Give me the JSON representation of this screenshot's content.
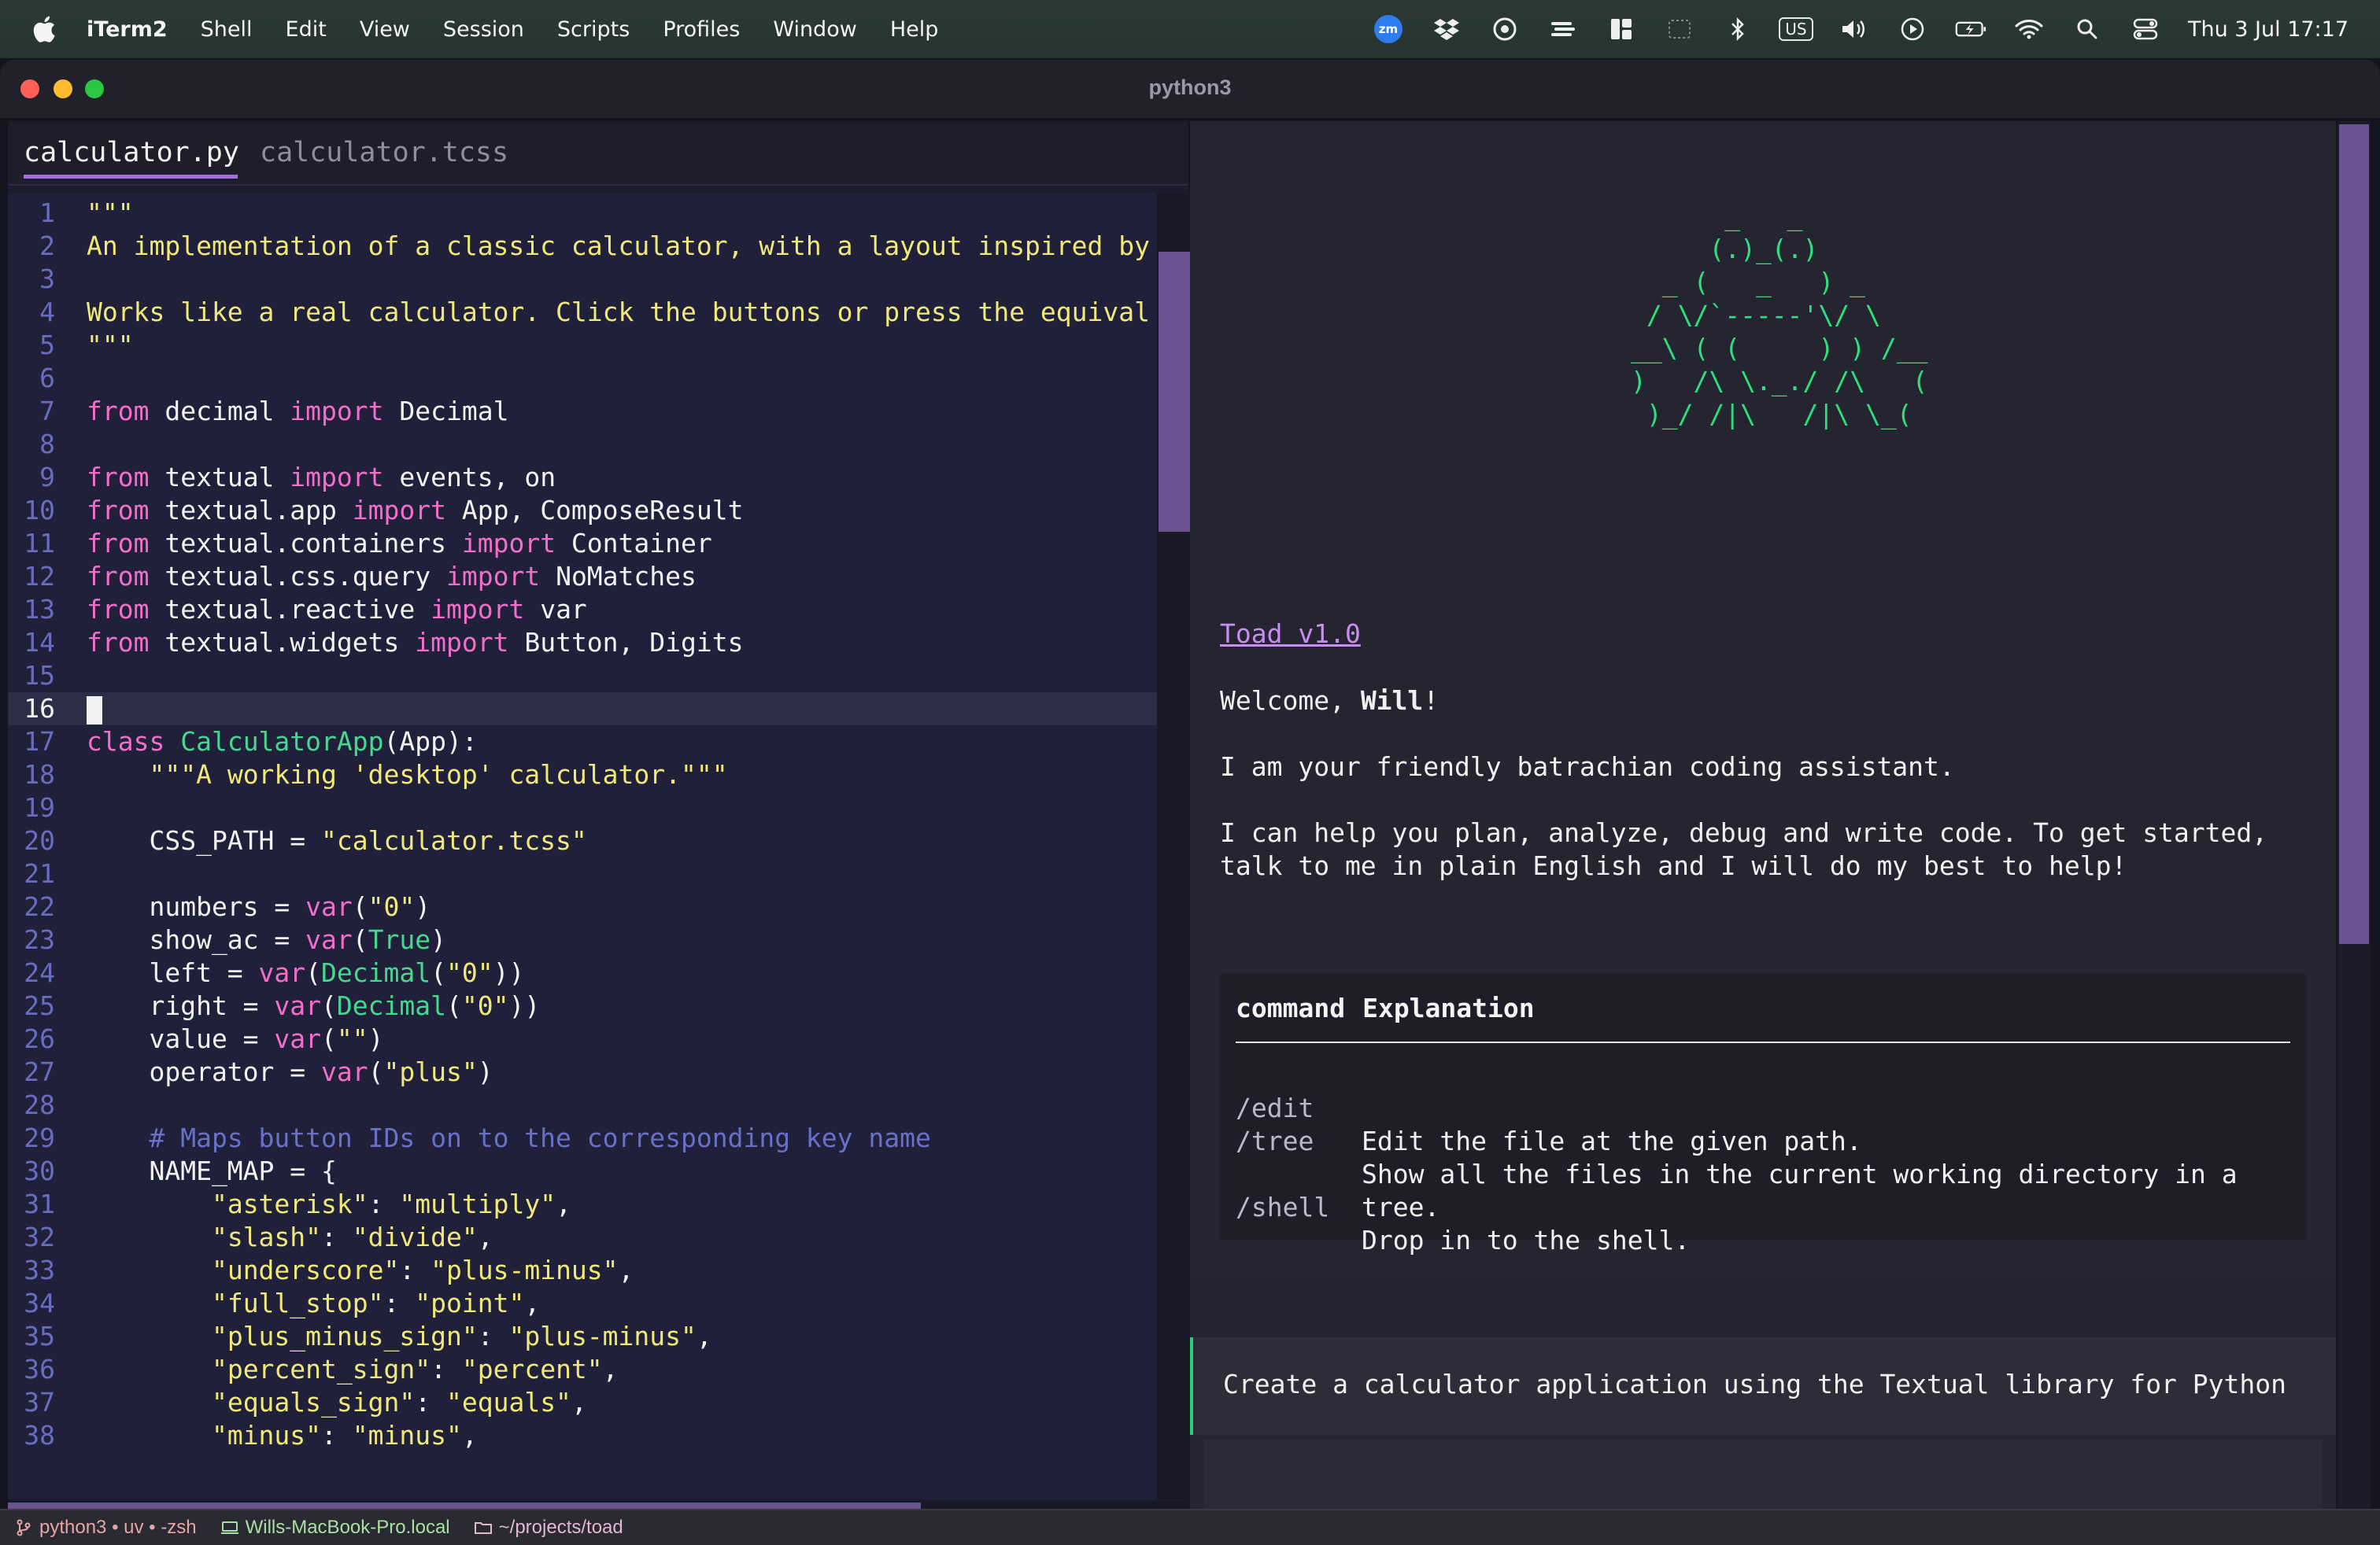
{
  "menubar": {
    "app_name": "iTerm2",
    "items": [
      "Shell",
      "Edit",
      "View",
      "Session",
      "Scripts",
      "Profiles",
      "Window",
      "Help"
    ],
    "status_icons": [
      "zoom-icon",
      "dropbox-icon",
      "screen-record-icon",
      "sync-icon",
      "layout-icon",
      "dashed-box-icon",
      "bluetooth-icon",
      "keyboard-layout-icon",
      "volume-icon",
      "play-icon",
      "battery-icon",
      "wifi-icon",
      "spotlight-icon",
      "control-center-icon"
    ],
    "zoom_label": "zm",
    "keyboard_label": "US",
    "clock": "Thu 3 Jul  17:17"
  },
  "window": {
    "title": "python3"
  },
  "editor": {
    "tabs": [
      {
        "label": "calculator.py",
        "active": true
      },
      {
        "label": "calculator.tcss",
        "active": false
      }
    ],
    "current_line": 16,
    "lines": [
      {
        "n": "1",
        "tokens": [
          [
            "str",
            "\"\"\""
          ]
        ]
      },
      {
        "n": "2",
        "tokens": [
          [
            "str",
            "An implementation of a classic calculator, with a layout inspired by"
          ]
        ]
      },
      {
        "n": "3",
        "tokens": []
      },
      {
        "n": "4",
        "tokens": [
          [
            "str",
            "Works like a real calculator. Click the buttons or press the equival"
          ]
        ]
      },
      {
        "n": "5",
        "tokens": [
          [
            "str",
            "\"\"\""
          ]
        ]
      },
      {
        "n": "6",
        "tokens": []
      },
      {
        "n": "7",
        "tokens": [
          [
            "kw",
            "from"
          ],
          [
            "txt",
            " decimal "
          ],
          [
            "kw",
            "import"
          ],
          [
            "txt",
            " Decimal"
          ]
        ]
      },
      {
        "n": "8",
        "tokens": []
      },
      {
        "n": "9",
        "tokens": [
          [
            "kw",
            "from"
          ],
          [
            "txt",
            " textual "
          ],
          [
            "kw",
            "import"
          ],
          [
            "txt",
            " events, on"
          ]
        ]
      },
      {
        "n": "10",
        "tokens": [
          [
            "kw",
            "from"
          ],
          [
            "txt",
            " textual.app "
          ],
          [
            "kw",
            "import"
          ],
          [
            "txt",
            " App, ComposeResult"
          ]
        ]
      },
      {
        "n": "11",
        "tokens": [
          [
            "kw",
            "from"
          ],
          [
            "txt",
            " textual.containers "
          ],
          [
            "kw",
            "import"
          ],
          [
            "txt",
            " Container"
          ]
        ]
      },
      {
        "n": "12",
        "tokens": [
          [
            "kw",
            "from"
          ],
          [
            "txt",
            " textual.css.query "
          ],
          [
            "kw",
            "import"
          ],
          [
            "txt",
            " NoMatches"
          ]
        ]
      },
      {
        "n": "13",
        "tokens": [
          [
            "kw",
            "from"
          ],
          [
            "txt",
            " textual.reactive "
          ],
          [
            "kw",
            "import"
          ],
          [
            "txt",
            " var"
          ]
        ]
      },
      {
        "n": "14",
        "tokens": [
          [
            "kw",
            "from"
          ],
          [
            "txt",
            " textual.widgets "
          ],
          [
            "kw",
            "import"
          ],
          [
            "txt",
            " Button, Digits"
          ]
        ]
      },
      {
        "n": "15",
        "tokens": []
      },
      {
        "n": "16",
        "tokens": [
          [
            "caret",
            ""
          ]
        ]
      },
      {
        "n": "17",
        "tokens": [
          [
            "kw",
            "class"
          ],
          [
            "txt",
            " "
          ],
          [
            "cls",
            "CalculatorApp"
          ],
          [
            "txt",
            "(App):"
          ]
        ]
      },
      {
        "n": "18",
        "tokens": [
          [
            "txt",
            "    "
          ],
          [
            "str",
            "\"\"\"A working 'desktop' calculator.\"\"\""
          ]
        ]
      },
      {
        "n": "19",
        "tokens": []
      },
      {
        "n": "20",
        "tokens": [
          [
            "txt",
            "    CSS_PATH = "
          ],
          [
            "str",
            "\"calculator.tcss\""
          ]
        ]
      },
      {
        "n": "21",
        "tokens": []
      },
      {
        "n": "22",
        "tokens": [
          [
            "txt",
            "    numbers = "
          ],
          [
            "kw",
            "var"
          ],
          [
            "txt",
            "("
          ],
          [
            "str",
            "\"0\""
          ],
          [
            "txt",
            ")"
          ]
        ]
      },
      {
        "n": "23",
        "tokens": [
          [
            "txt",
            "    show_ac = "
          ],
          [
            "kw",
            "var"
          ],
          [
            "txt",
            "("
          ],
          [
            "cls",
            "True"
          ],
          [
            "txt",
            ")"
          ]
        ]
      },
      {
        "n": "24",
        "tokens": [
          [
            "txt",
            "    left = "
          ],
          [
            "kw",
            "var"
          ],
          [
            "txt",
            "("
          ],
          [
            "fn",
            "Decimal"
          ],
          [
            "txt",
            "("
          ],
          [
            "str",
            "\"0\""
          ],
          [
            "txt",
            "))"
          ]
        ]
      },
      {
        "n": "25",
        "tokens": [
          [
            "txt",
            "    right = "
          ],
          [
            "kw",
            "var"
          ],
          [
            "txt",
            "("
          ],
          [
            "fn",
            "Decimal"
          ],
          [
            "txt",
            "("
          ],
          [
            "str",
            "\"0\""
          ],
          [
            "txt",
            "))"
          ]
        ]
      },
      {
        "n": "26",
        "tokens": [
          [
            "txt",
            "    value = "
          ],
          [
            "kw",
            "var"
          ],
          [
            "txt",
            "("
          ],
          [
            "str",
            "\"\""
          ],
          [
            "txt",
            ")"
          ]
        ]
      },
      {
        "n": "27",
        "tokens": [
          [
            "txt",
            "    operator = "
          ],
          [
            "kw",
            "var"
          ],
          [
            "txt",
            "("
          ],
          [
            "str",
            "\"plus\""
          ],
          [
            "txt",
            ")"
          ]
        ]
      },
      {
        "n": "28",
        "tokens": []
      },
      {
        "n": "29",
        "tokens": [
          [
            "txt",
            "    "
          ],
          [
            "cmt",
            "# Maps button IDs on to the corresponding key name"
          ]
        ]
      },
      {
        "n": "30",
        "tokens": [
          [
            "txt",
            "    NAME_MAP = {"
          ]
        ]
      },
      {
        "n": "31",
        "tokens": [
          [
            "txt",
            "        "
          ],
          [
            "str",
            "\"asterisk\""
          ],
          [
            "txt",
            ": "
          ],
          [
            "str",
            "\"multiply\""
          ],
          [
            "txt",
            ","
          ]
        ]
      },
      {
        "n": "32",
        "tokens": [
          [
            "txt",
            "        "
          ],
          [
            "str",
            "\"slash\""
          ],
          [
            "txt",
            ": "
          ],
          [
            "str",
            "\"divide\""
          ],
          [
            "txt",
            ","
          ]
        ]
      },
      {
        "n": "33",
        "tokens": [
          [
            "txt",
            "        "
          ],
          [
            "str",
            "\"underscore\""
          ],
          [
            "txt",
            ": "
          ],
          [
            "str",
            "\"plus-minus\""
          ],
          [
            "txt",
            ","
          ]
        ]
      },
      {
        "n": "34",
        "tokens": [
          [
            "txt",
            "        "
          ],
          [
            "str",
            "\"full_stop\""
          ],
          [
            "txt",
            ": "
          ],
          [
            "str",
            "\"point\""
          ],
          [
            "txt",
            ","
          ]
        ]
      },
      {
        "n": "35",
        "tokens": [
          [
            "txt",
            "        "
          ],
          [
            "str",
            "\"plus_minus_sign\""
          ],
          [
            "txt",
            ": "
          ],
          [
            "str",
            "\"plus-minus\""
          ],
          [
            "txt",
            ","
          ]
        ]
      },
      {
        "n": "36",
        "tokens": [
          [
            "txt",
            "        "
          ],
          [
            "str",
            "\"percent_sign\""
          ],
          [
            "txt",
            ": "
          ],
          [
            "str",
            "\"percent\""
          ],
          [
            "txt",
            ","
          ]
        ]
      },
      {
        "n": "37",
        "tokens": [
          [
            "txt",
            "        "
          ],
          [
            "str",
            "\"equals_sign\""
          ],
          [
            "txt",
            ": "
          ],
          [
            "str",
            "\"equals\""
          ],
          [
            "txt",
            ","
          ]
        ]
      },
      {
        "n": "38",
        "tokens": [
          [
            "txt",
            "        "
          ],
          [
            "str",
            "\"minus\""
          ],
          [
            "txt",
            ": "
          ],
          [
            "str",
            "\"minus\""
          ],
          [
            "txt",
            ","
          ]
        ]
      }
    ]
  },
  "assistant": {
    "ascii_art": "      _   _\n     (.)_(.)\n  _ (   _   ) _\n / \\/`-----'\\/ \\\n__\\ ( (     ) ) /__\n)   /\\ \\._./ /\\   (\n )_/ /|\\   /|\\ \\_(",
    "version_link": "Toad v1.0",
    "welcome_prefix": "Welcome, ",
    "welcome_name": "Will",
    "welcome_suffix": "!",
    "intro": "I am your friendly batrachian coding assistant.",
    "help_line1": "I can help you plan, analyze, debug and write code. To get started,",
    "help_line2": "talk to me in plain English and I will do my best to help!",
    "command_table": {
      "header_command": "command",
      "header_explanation": "Explanation",
      "rows": [
        {
          "command": "/edit",
          "explanation": "Edit the file at the given path."
        },
        {
          "command": "/tree",
          "explanation": "Show all the files in the current working directory in a tree."
        },
        {
          "command": "/shell",
          "explanation": "Drop in to the shell."
        }
      ]
    },
    "prompt": "Create a calculator application using the Textual library for Python",
    "input_value": ""
  },
  "statusbar": {
    "session": "python3 • uv • -zsh",
    "host": "Wills-MacBook-Pro.local",
    "path": "~/projects/toad"
  },
  "colors": {
    "keyword": "#f16fc9",
    "string": "#efe977",
    "class_name": "#46d88e",
    "comment": "#6870c8",
    "ascii_art": "#2de07c",
    "link": "#c88df2",
    "scroll_thumb": "#6a5293",
    "prompt_accent": "#2dce7a"
  }
}
